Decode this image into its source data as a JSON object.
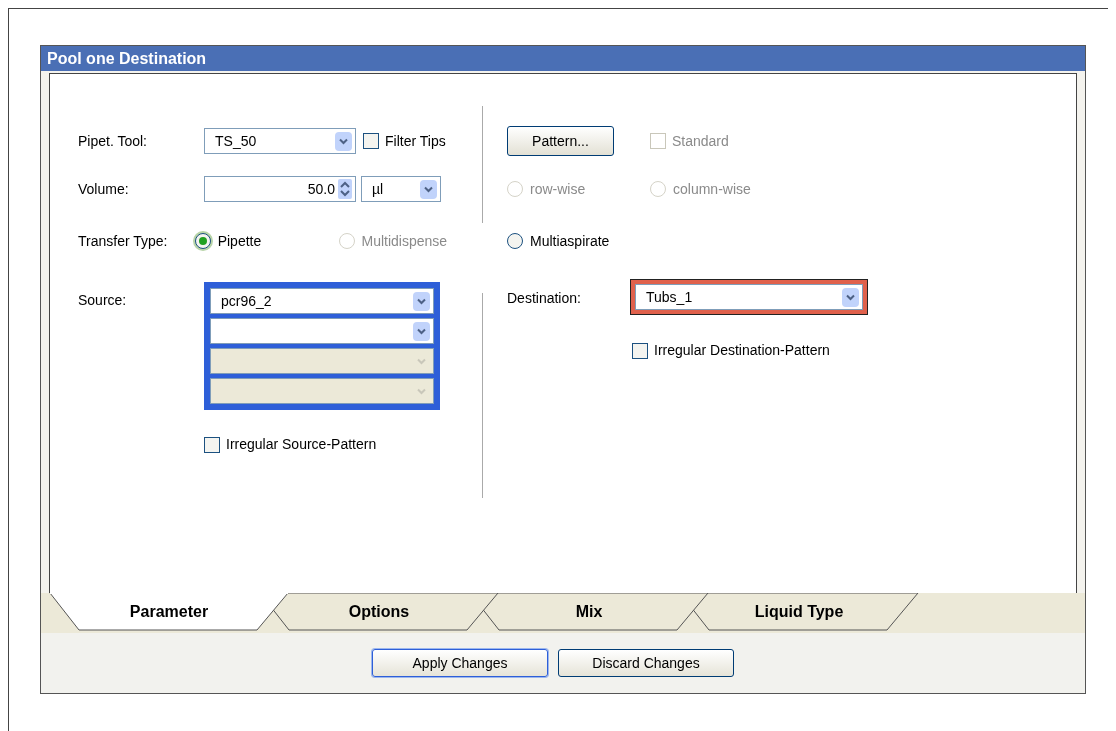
{
  "dialog": {
    "title": "Pool one Destination"
  },
  "pipet_tool": {
    "label": "Pipet. Tool:",
    "value": "TS_50"
  },
  "filter_tips": {
    "label": "Filter Tips",
    "checked": false,
    "disabled": false
  },
  "pattern_button": {
    "label": "Pattern..."
  },
  "standard": {
    "label": "Standard",
    "checked": false,
    "disabled": true
  },
  "volume": {
    "label": "Volume:",
    "value": "50.0",
    "unit": "µl"
  },
  "order_options": [
    {
      "label": "row-wise",
      "selected": false,
      "disabled": true
    },
    {
      "label": "column-wise",
      "selected": false,
      "disabled": true
    }
  ],
  "transfer_type": {
    "label": "Transfer Type:",
    "options": [
      {
        "label": "Pipette",
        "selected": true,
        "disabled": false
      },
      {
        "label": "Multidispense",
        "selected": false,
        "disabled": true
      },
      {
        "label": "Multiaspirate",
        "selected": false,
        "disabled": false
      }
    ]
  },
  "source": {
    "label": "Source:",
    "selectors": [
      {
        "value": "pcr96_2",
        "disabled": false
      },
      {
        "disabled": false
      },
      {
        "disabled": true
      },
      {
        "disabled": true
      }
    ],
    "irregular": {
      "label": "Irregular Source-Pattern",
      "checked": false
    }
  },
  "destination": {
    "label": "Destination:",
    "value": "Tubs_1",
    "irregular": {
      "label": "Irregular Destination-Pattern",
      "checked": false
    }
  },
  "tabs": [
    {
      "label": "Parameter",
      "selected": true
    },
    {
      "label": "Options",
      "selected": false
    },
    {
      "label": "Mix",
      "selected": false
    },
    {
      "label": "Liquid Type",
      "selected": false
    }
  ],
  "buttons": [
    {
      "label": "Apply Changes",
      "default": true
    },
    {
      "label": "Discard Changes",
      "default": false
    }
  ]
}
